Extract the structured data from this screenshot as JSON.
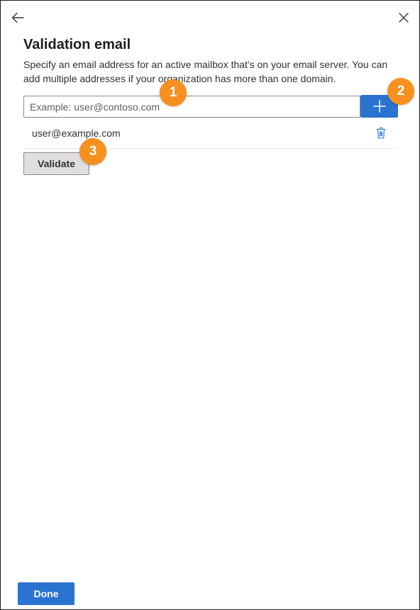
{
  "header": {
    "back_icon": "arrow-left-icon",
    "close_icon": "close-icon"
  },
  "content": {
    "title": "Validation email",
    "description": "Specify an email address for an active mailbox that's on your email server. You can add multiple addresses if your organization has more than one domain.",
    "input_placeholder": "Example: user@contoso.com",
    "input_value": "",
    "add_icon": "plus-icon",
    "emails": [
      "user@example.com"
    ],
    "delete_icon": "trash-icon",
    "validate_label": "Validate"
  },
  "callouts": [
    "1",
    "2",
    "3"
  ],
  "footer": {
    "done_label": "Done"
  },
  "colors": {
    "primary": "#2b73d1",
    "callout": "#f7901e",
    "delete_icon": "#2b73d1"
  }
}
